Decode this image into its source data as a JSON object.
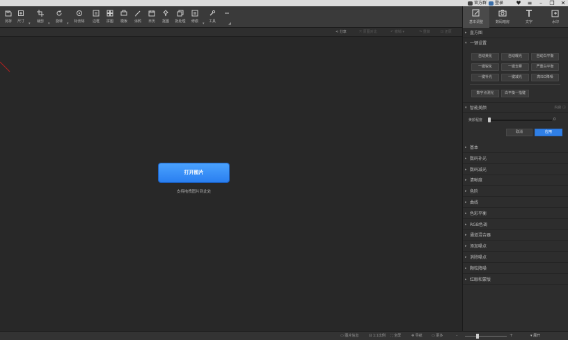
{
  "titlebar": {
    "official_site": "官方群",
    "login": "登录"
  },
  "toolbar": {
    "tools": [
      "另存",
      "尺寸",
      "裁剪",
      "旋转",
      "标去除",
      "边框",
      "拼图",
      "模板",
      "涂鸦",
      "日历",
      "抠图",
      "批处理",
      "修痕",
      "工具"
    ]
  },
  "subbar": {
    "share": "分享",
    "compare": "原图对比",
    "undo": "撤销",
    "redo": "重做",
    "reset": "还原"
  },
  "canvas": {
    "open_button": "打开图片",
    "hint": "支持拖拽图片到此处"
  },
  "status": {
    "info": "图片信息",
    "ratio": "1:1比例",
    "fit": "全屏",
    "nav": "导航",
    "size": "更多",
    "expand": "展开"
  },
  "right_panel": {
    "tabs": [
      {
        "label": "基本调整",
        "icon": "edit-icon"
      },
      {
        "label": "数码暗房",
        "icon": "camera-icon"
      },
      {
        "label": "文字",
        "icon": "text-icon"
      },
      {
        "label": "水印",
        "icon": "watermark-icon"
      }
    ],
    "histogram": "直方图",
    "oneclick": {
      "title": "一键设置",
      "buttons": [
        "自动美化",
        "自动曝光",
        "自动白平衡",
        "一键锐化",
        "一键去雾",
        "严重白平衡",
        "一键补光",
        "一键减光",
        "高ISO降噪"
      ],
      "more": [
        "数字点测光",
        "白平衡一指键"
      ]
    },
    "smart": {
      "title": "智能美颜",
      "extra": "内容",
      "slider_label": "美颜程度",
      "slider_value": "0",
      "slider_fraction": 0,
      "cancel": "取消",
      "apply": "应用"
    },
    "sections": [
      "基本",
      "数码补光",
      "数码减光",
      "清晰度",
      "色阶",
      "曲线",
      "色彩平衡",
      "RGB色调",
      "通道混合器",
      "添加噪点",
      "消除噪点",
      "颗粒降噪",
      "红眼和蒙版"
    ]
  }
}
